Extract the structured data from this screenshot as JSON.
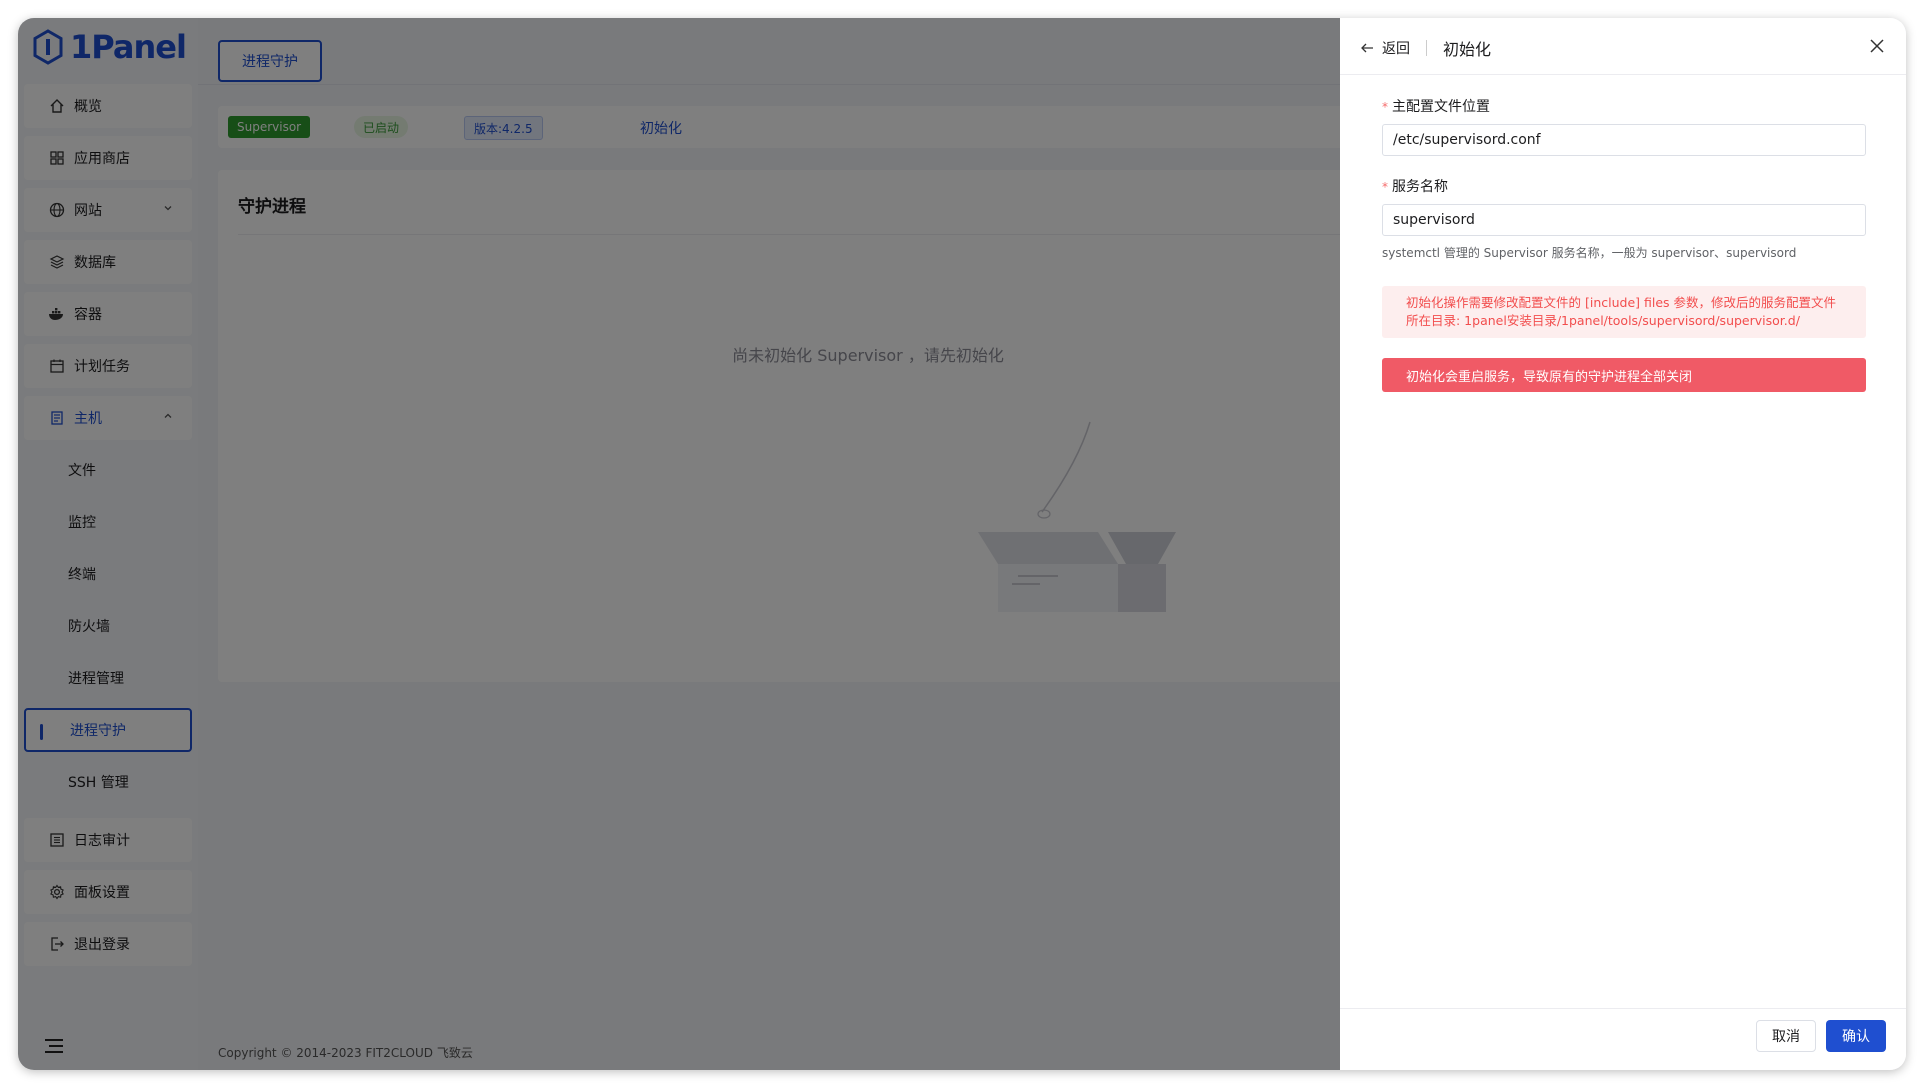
{
  "app": {
    "logo_text": "1Panel"
  },
  "sidebar": {
    "items": [
      {
        "label": "概览",
        "icon": "home-icon"
      },
      {
        "label": "应用商店",
        "icon": "grid-icon"
      },
      {
        "label": "网站",
        "icon": "globe-icon"
      },
      {
        "label": "数据库",
        "icon": "database-icon"
      },
      {
        "label": "容器",
        "icon": "docker-icon"
      },
      {
        "label": "计划任务",
        "icon": "calendar-icon"
      },
      {
        "label": "主机",
        "icon": "host-icon"
      }
    ],
    "host_sub": [
      "文件",
      "监控",
      "终端",
      "防火墙",
      "进程管理",
      "进程守护",
      "SSH 管理"
    ],
    "bottom_items": [
      {
        "label": "日志审计",
        "icon": "log-icon"
      },
      {
        "label": "面板设置",
        "icon": "gear-icon"
      },
      {
        "label": "退出登录",
        "icon": "logout-icon"
      }
    ]
  },
  "main": {
    "tab_label": "进程守护",
    "badges": {
      "name": "Supervisor",
      "status": "已启动",
      "version": "版本:4.2.5"
    },
    "init_link": "初始化",
    "card_title": "守护进程",
    "empty_text": "尚未初始化 Supervisor ，请先初始化",
    "footer": "Copyright © 2014-2023 FIT2CLOUD 飞致云"
  },
  "drawer": {
    "back_label": "返回",
    "title": "初始化",
    "config_label": "主配置文件位置",
    "config_value": "/etc/supervisord.conf",
    "service_label": "服务名称",
    "service_value": "supervisord",
    "help_text": "systemctl 管理的 Supervisor 服务名称，一般为 supervisor、supervisord",
    "alert_line1": "初始化操作需要修改配置文件的 [include] files 参数，修改后的服务配置文件",
    "alert_line2": "所在目录: 1panel安装目录/1panel/tools/supervisord/supervisor.d/",
    "alert_danger": "初始化会重启服务，导致原有的守护进程全部关闭",
    "cancel_label": "取消",
    "confirm_label": "确认"
  },
  "colors": {
    "accent": "#1f4fd0",
    "danger": "#f05a66",
    "success": "#2e9d2e"
  }
}
